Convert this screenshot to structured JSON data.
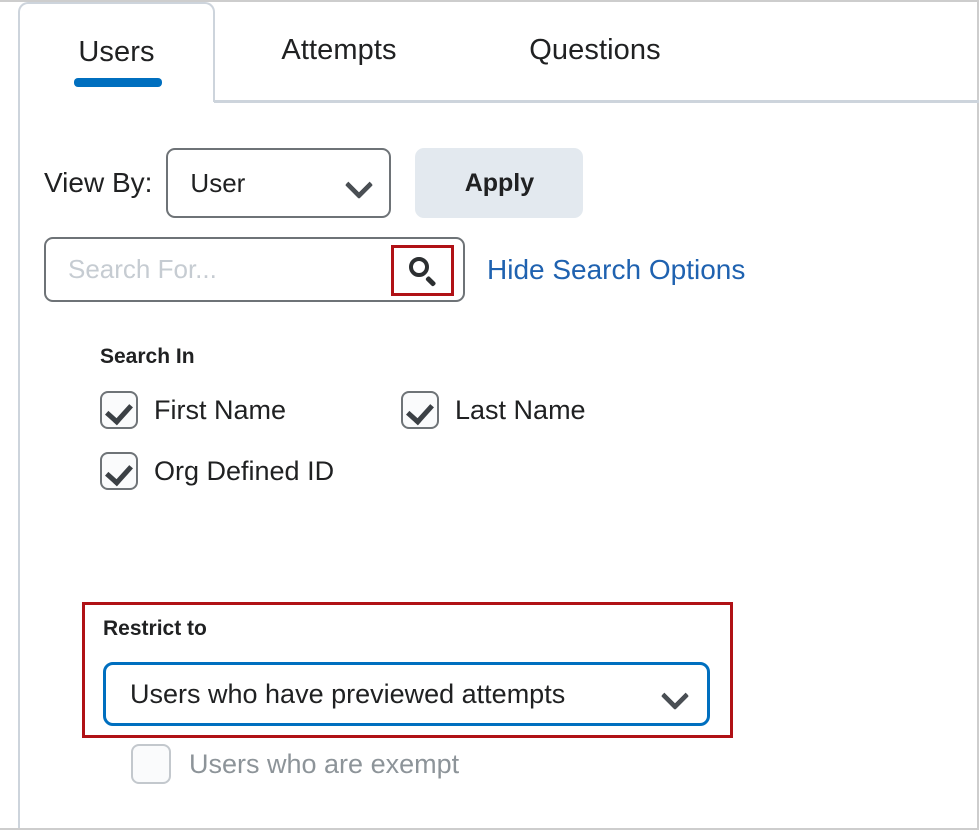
{
  "tabs": [
    {
      "label": "Users",
      "active": true
    },
    {
      "label": "Attempts",
      "active": false
    },
    {
      "label": "Questions",
      "active": false
    }
  ],
  "toolbar": {
    "view_by_label": "View By:",
    "view_by_value": "User",
    "apply_label": "Apply"
  },
  "search": {
    "placeholder": "Search For...",
    "value": "",
    "icon": "search-icon",
    "hide_options_link": "Hide Search Options"
  },
  "search_in": {
    "title": "Search In",
    "options": [
      {
        "label": "First Name",
        "checked": true,
        "disabled": false
      },
      {
        "label": "Last Name",
        "checked": true,
        "disabled": false
      },
      {
        "label": "Org Defined ID",
        "checked": true,
        "disabled": false
      }
    ]
  },
  "restrict_to": {
    "title": "Restrict to",
    "selected": "Users who have previewed attempts",
    "chevron_icon": "chevron-down-icon"
  },
  "exempt": {
    "label": "Users who are exempt",
    "checked": false,
    "disabled": true
  },
  "colors": {
    "tab_active_indicator": "#006fbf",
    "link": "#1f62b0",
    "highlight_box": "#b01116",
    "select_focus": "#006fbf",
    "apply_button_bg": "#e3e9ef",
    "border": "#cdd4dc"
  }
}
